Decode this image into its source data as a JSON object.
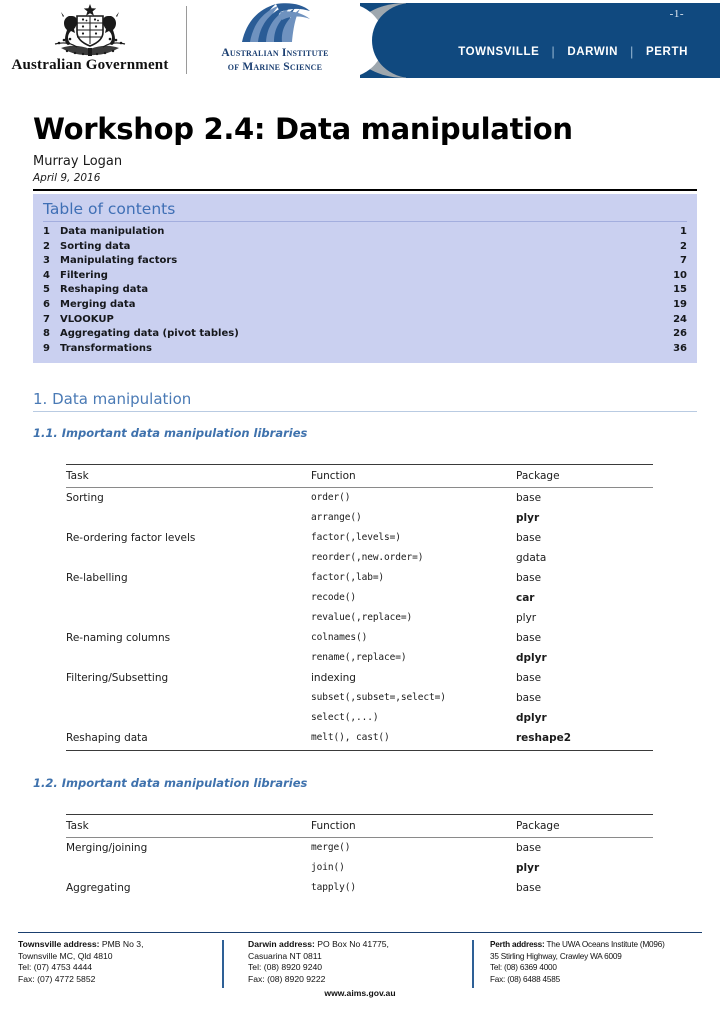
{
  "header": {
    "page_number": "-1-",
    "government_label": "Australian Government",
    "institute_line1": "Australian Institute",
    "institute_line2": "of Marine Science",
    "cities": [
      "TOWNSVILLE",
      "DARWIN",
      "PERTH"
    ],
    "city_separator": "|",
    "banner_color": "#10497f"
  },
  "document": {
    "title": "Workshop 2.4: Data manipulation",
    "author": "Murray Logan",
    "date": "April 9, 2016"
  },
  "toc": {
    "heading": "Table of contents",
    "entries": [
      {
        "num": "1",
        "label": "Data manipulation",
        "page": "1"
      },
      {
        "num": "2",
        "label": "Sorting data",
        "page": "2"
      },
      {
        "num": "3",
        "label": "Manipulating factors",
        "page": "7"
      },
      {
        "num": "4",
        "label": "Filtering",
        "page": "10"
      },
      {
        "num": "5",
        "label": "Reshaping data",
        "page": "15"
      },
      {
        "num": "6",
        "label": "Merging data",
        "page": "19"
      },
      {
        "num": "7",
        "label": "VLOOKUP",
        "page": "24"
      },
      {
        "num": "8",
        "label": "Aggregating data (pivot tables)",
        "page": "26"
      },
      {
        "num": "9",
        "label": "Transformations",
        "page": "36"
      }
    ]
  },
  "sections": {
    "s1_heading": "1. Data manipulation",
    "s11_heading": "1.1. Important data manipulation libraries",
    "s12_heading": "1.2. Important data manipulation libraries"
  },
  "table1": {
    "columns": [
      "Task",
      "Function",
      "Package"
    ],
    "rows": [
      {
        "task": "Sorting",
        "function": "order()",
        "package": "base",
        "package_bold": false
      },
      {
        "task": "",
        "function": "arrange()",
        "package": "plyr",
        "package_bold": true
      },
      {
        "task": "Re-ordering factor levels",
        "function": "factor(,levels=)",
        "package": "base",
        "package_bold": false
      },
      {
        "task": "",
        "function": "reorder(,new.order=)",
        "package": "gdata",
        "package_bold": false
      },
      {
        "task": "Re-labelling",
        "function": "factor(,lab=)",
        "package": "base",
        "package_bold": false
      },
      {
        "task": "",
        "function": "recode()",
        "package": "car",
        "package_bold": true
      },
      {
        "task": "",
        "function": "revalue(,replace=)",
        "package": "plyr",
        "package_bold": false
      },
      {
        "task": "Re-naming columns",
        "function": "colnames()",
        "package": "base",
        "package_bold": false
      },
      {
        "task": "",
        "function": "rename(,replace=)",
        "package": "dplyr",
        "package_bold": true
      },
      {
        "task": "Filtering/Subsetting",
        "function": "indexing",
        "package": "base",
        "package_bold": false,
        "function_mono": false
      },
      {
        "task": "",
        "function": "subset(,subset=,select=)",
        "package": "base",
        "package_bold": false
      },
      {
        "task": "",
        "function": "select(,...)",
        "package": "dplyr",
        "package_bold": true
      },
      {
        "task": "Reshaping data",
        "function": "melt(), cast()",
        "package": "reshape2",
        "package_bold": true
      }
    ]
  },
  "table2": {
    "columns": [
      "Task",
      "Function",
      "Package"
    ],
    "rows": [
      {
        "task": "Merging/joining",
        "function": "merge()",
        "package": "base",
        "package_bold": false
      },
      {
        "task": "",
        "function": "join()",
        "package": "plyr",
        "package_bold": true
      },
      {
        "task": "Aggregating",
        "function": "tapply()",
        "package": "base",
        "package_bold": false
      }
    ]
  },
  "footer": {
    "townsville": {
      "label": "Townsville address:",
      "line1": " PMB No 3,",
      "line2": "Townsville MC, Qld 4810",
      "line3": "Tel: (07) 4753 4444",
      "line4": "Fax: (07) 4772 5852"
    },
    "darwin": {
      "label": "Darwin address:",
      "line1": " PO Box No 41775,",
      "line2": "Casuarina NT 0811",
      "line3": "Tel: (08) 8920 9240",
      "line4": "Fax: (08) 8920 9222"
    },
    "perth": {
      "label": "Perth address:",
      "line1": " The UWA Oceans Institute (M096)",
      "line2": "35 Stirling Highway, Crawley WA 6009",
      "line3": "Tel: (08) 6369 4000",
      "line4": "Fax: (08) 6488 4585"
    },
    "website": "www.aims.gov.au"
  }
}
